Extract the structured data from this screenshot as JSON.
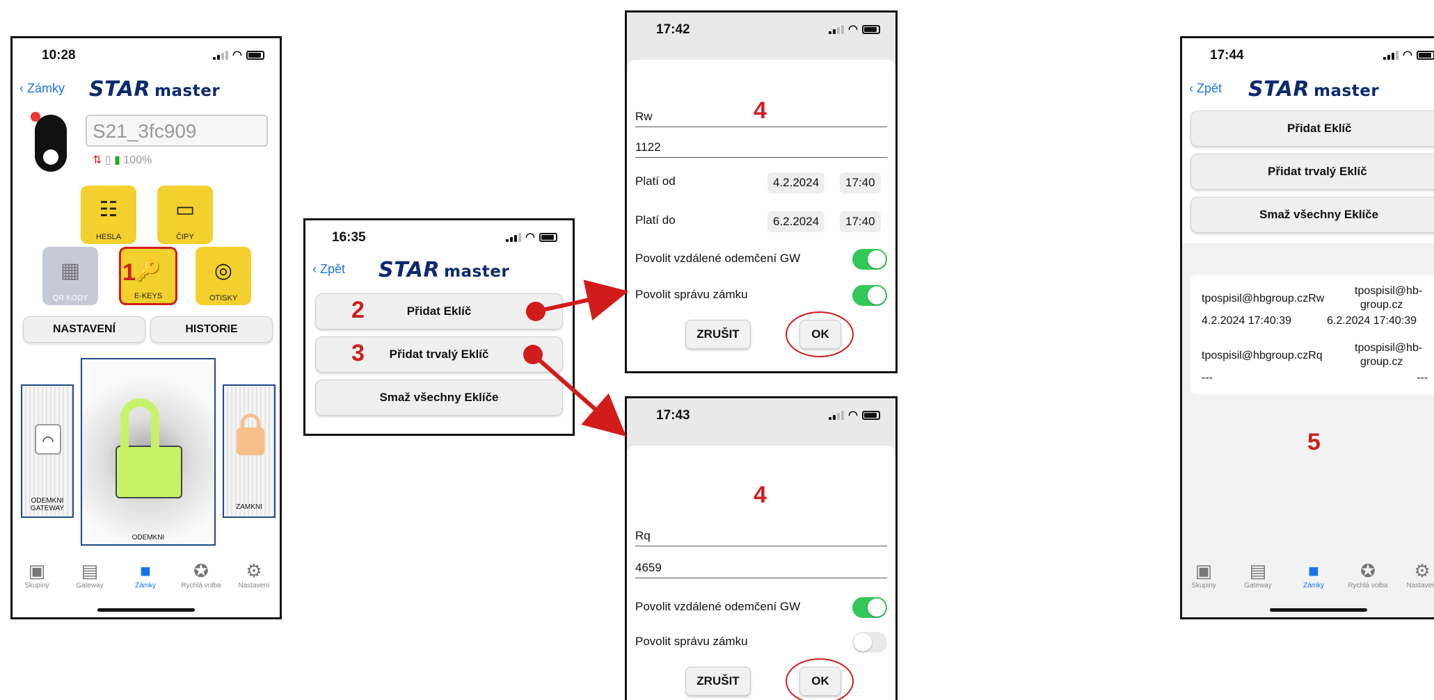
{
  "screen1": {
    "time": "10:28",
    "back": "Zámky",
    "brand_star": "STAR",
    "brand_master": "master",
    "device_name": "S21_3fc909",
    "battery": "100%",
    "tiles": {
      "hesla": "HESLA",
      "cipy": "ČIPY",
      "qr": "QR KÓDY",
      "ekeys": "E-KEYS",
      "otisky": "OTISKY"
    },
    "step": "1",
    "nastaveni": "NASTAVENÍ",
    "historie": "HISTORIE",
    "odemkni_gateway": "ODEMKNI GATEWAY",
    "odemkni": "ODEMKNI",
    "zamkni": "ZAMKNI",
    "tabs": [
      "Skupiny",
      "Gateway",
      "Zámky",
      "Rychlá volba",
      "Nastavení"
    ]
  },
  "screen2": {
    "time": "16:35",
    "back": "Zpět",
    "brand_star": "STAR",
    "brand_master": "master",
    "btn_add": "Přidat Eklíč",
    "btn_add_perm": "Přidat trvalý Eklíč",
    "btn_delete": "Smaž všechny Eklíče",
    "step_add": "2",
    "step_perm": "3"
  },
  "screen3": {
    "time": "17:42",
    "step": "4",
    "name": "Rw",
    "code": "1122",
    "valid_from_label": "Platí od",
    "valid_from_date": "4.2.2024",
    "valid_from_time": "17:40",
    "valid_to_label": "Platí do",
    "valid_to_date": "6.2.2024",
    "valid_to_time": "17:40",
    "remote_label": "Povolit vzdálené odemčení GW",
    "manage_label": "Povolit správu zámku",
    "cancel": "ZRUŠIT",
    "ok": "OK"
  },
  "screen4": {
    "time": "17:43",
    "step": "4",
    "name": "Rq",
    "code": "4659",
    "remote_label": "Povolit vzdálené odemčení GW",
    "manage_label": "Povolit správu zámku",
    "cancel": "ZRUŠIT",
    "ok": "OK"
  },
  "screen5": {
    "time": "17:44",
    "back": "Zpět",
    "brand_star": "STAR",
    "brand_master": "master",
    "btn_add": "Přidat Eklíč",
    "btn_add_perm": "Přidat trvalý Eklíč",
    "btn_delete": "Smaž všechny Eklíče",
    "key1_name": "tpospisil@hbgroup.czRw",
    "key1_owner_a": "tpospisil@hb-",
    "key1_owner_b": "group.cz",
    "key1_from": "4.2.2024 17:40:39",
    "key1_to": "6.2.2024 17:40:39",
    "key2_name": "tpospisil@hbgroup.czRq",
    "key2_owner_a": "tpospisil@hb-",
    "key2_owner_b": "group.cz",
    "key2_from": "---",
    "key2_to": "---",
    "step": "5",
    "tabs": [
      "Skupiny",
      "Gateway",
      "Zámky",
      "Rychlá volba",
      "Nastavení"
    ]
  },
  "colors": {
    "accent": "#1a73e8",
    "brand": "#0b2a6f",
    "step_red": "#cc1f1f",
    "tile_yellow": "#f3d02e",
    "toggle_green": "#34c759",
    "lock_green": "#c6f26a"
  }
}
